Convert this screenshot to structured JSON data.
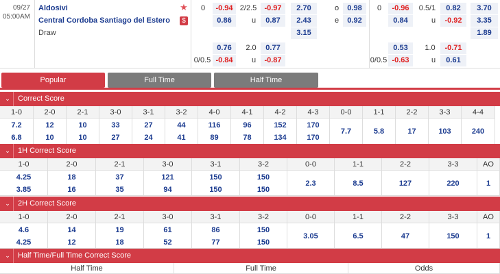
{
  "match": {
    "date": "09/27",
    "time": "05:00AM",
    "home": "Aldosivi",
    "away": "Central Cordoba Santiago del Estero",
    "draw": "Draw",
    "ft": {
      "hdp_line_top": "0",
      "hdp_home": "-0.94",
      "hdp_away": "0.86",
      "ou_line_top": "2/2.5",
      "ou_over": "-0.97",
      "ou_u": "u",
      "ou_under": "0.87",
      "x12_home": "2.70",
      "x12_away": "2.43",
      "x12_draw": "3.15",
      "oe_o": "o",
      "oe_e": "e",
      "oe_odd": "0.98",
      "oe_even": "0.92",
      "hdp2_line": "0/0.5",
      "hdp2_home": "0.76",
      "hdp2_away": "-0.84",
      "ou2_line": "2.0",
      "ou2_over": "0.77",
      "ou2_u": "u",
      "ou2_under": "-0.87"
    },
    "ht": {
      "hdp_line_top": "0",
      "hdp_home": "-0.96",
      "hdp_away": "0.84",
      "ou_line_top": "0.5/1",
      "ou_over": "0.82",
      "ou_u": "u",
      "ou_under": "-0.92",
      "x12_home": "3.70",
      "x12_away": "3.35",
      "x12_draw": "1.89",
      "hdp2_line": "0/0.5",
      "hdp2_home": "0.53",
      "hdp2_away": "-0.63",
      "ou2_line": "1.0",
      "ou2_over": "-0.71",
      "ou2_u": "u",
      "ou2_under": "0.61"
    },
    "star_icon": "star-icon",
    "dollar_icon": "dollar-icon"
  },
  "tabs": {
    "popular": "Popular",
    "full_time": "Full Time",
    "half_time": "Half Time"
  },
  "correct_score": {
    "title": "Correct Score",
    "headers": [
      "1-0",
      "2-0",
      "2-1",
      "3-0",
      "3-1",
      "3-2",
      "4-0",
      "4-1",
      "4-2",
      "4-3",
      "0-0",
      "1-1",
      "2-2",
      "3-3",
      "4-4"
    ],
    "row1": [
      "7.2",
      "12",
      "10",
      "33",
      "27",
      "44",
      "116",
      "96",
      "152",
      "170",
      "7.7",
      "5.8",
      "17",
      "103",
      "240"
    ],
    "row2": [
      "6.8",
      "10",
      "10",
      "27",
      "24",
      "41",
      "89",
      "78",
      "134",
      "170",
      "",
      "",
      "",
      "",
      ""
    ]
  },
  "h1_correct_score": {
    "title": "1H Correct Score",
    "headers": [
      "1-0",
      "2-0",
      "2-1",
      "3-0",
      "3-1",
      "3-2",
      "0-0",
      "1-1",
      "2-2",
      "3-3",
      "AO"
    ],
    "row1": [
      "4.25",
      "18",
      "37",
      "121",
      "150",
      "150",
      "2.3",
      "8.5",
      "127",
      "220",
      "1"
    ],
    "row2": [
      "3.85",
      "16",
      "35",
      "94",
      "150",
      "150",
      "",
      "",
      "",
      "",
      ""
    ]
  },
  "h2_correct_score": {
    "title": "2H Correct Score",
    "headers": [
      "1-0",
      "2-0",
      "2-1",
      "3-0",
      "3-1",
      "3-2",
      "0-0",
      "1-1",
      "2-2",
      "3-3",
      "AO"
    ],
    "row1": [
      "4.6",
      "14",
      "19",
      "61",
      "86",
      "150",
      "3.05",
      "6.5",
      "47",
      "150",
      "1"
    ],
    "row2": [
      "4.25",
      "12",
      "18",
      "52",
      "77",
      "150",
      "",
      "",
      "",
      "",
      ""
    ]
  },
  "htft": {
    "title": "Half Time/Full Time Correct Score",
    "headers": [
      "Half Time",
      "Full Time",
      "Odds"
    ]
  }
}
